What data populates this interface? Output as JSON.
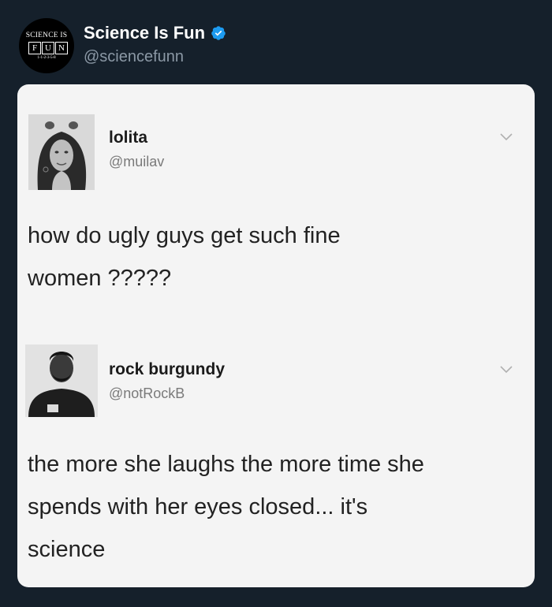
{
  "account": {
    "name": "Science Is Fun",
    "handle": "@sciencefunn",
    "logo": {
      "top_text": "SCIENCE IS",
      "letters": [
        "F",
        "U",
        "N"
      ],
      "bottom_text": "1-1-2-3-5-8"
    }
  },
  "tweets": [
    {
      "name": "lolita",
      "handle": "@muilav",
      "text_lines": [
        "how do ugly guys get such fine",
        "women ?????"
      ]
    },
    {
      "name": "rock burgundy",
      "handle": "@notRockB",
      "text_lines": [
        "the more she laughs the more time she",
        "spends with her eyes closed...  it's",
        "science"
      ]
    }
  ],
  "colors": {
    "background": "#15202b",
    "card": "#f4f4f4",
    "verified": "#1d9bf0"
  },
  "icons": [
    "verified-badge-icon",
    "chevron-down-icon"
  ]
}
